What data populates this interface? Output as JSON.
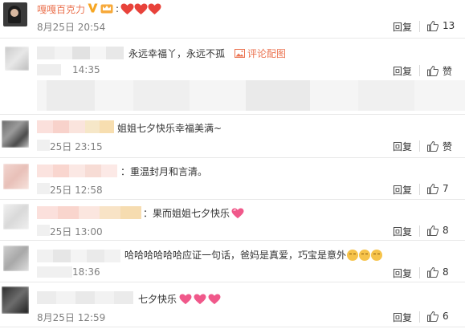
{
  "header": {
    "username": "嘎嘎百克力",
    "verified_icon": "verified-v-badge",
    "level_icon": "member-crown-badge",
    "separator": ":",
    "hearts_count": 3,
    "timestamp": "8月25日 20:54",
    "reply_label": "回复",
    "like_count": "13"
  },
  "comments": [
    {
      "text": "永远幸福丫，永远不孤",
      "image_link": "评论配图",
      "timestamp": "14:35",
      "reply_label": "回复",
      "like_count": "赞"
    },
    {
      "text": "姐姐七夕快乐幸福美满~",
      "timestamp": "25日 23:15",
      "reply_label": "回复",
      "like_count": "赞"
    },
    {
      "text": "：重温封月和言清。",
      "timestamp": "25日 12:58",
      "reply_label": "回复",
      "like_count": "7"
    },
    {
      "text": "：果而姐姐七夕快乐",
      "timestamp": "25日 13:00",
      "reply_label": "回复",
      "like_count": "8"
    },
    {
      "text": "哈哈哈哈哈哈应证一句话，爸妈是真爱，巧宝是意外",
      "timestamp": "18:36",
      "reply_label": "回复",
      "like_count": "8"
    },
    {
      "text": "七夕快乐",
      "timestamp": "8月25日 12:59",
      "reply_label": "回复",
      "like_count": "6"
    }
  ],
  "colors": {
    "link_orange": "#eb7350",
    "verified_orange": "#f6a623",
    "heart_red": "#e8423a",
    "heart_pink": "#f0588a",
    "timestamp_gray": "#808080",
    "divider": "#e8e8e8"
  }
}
